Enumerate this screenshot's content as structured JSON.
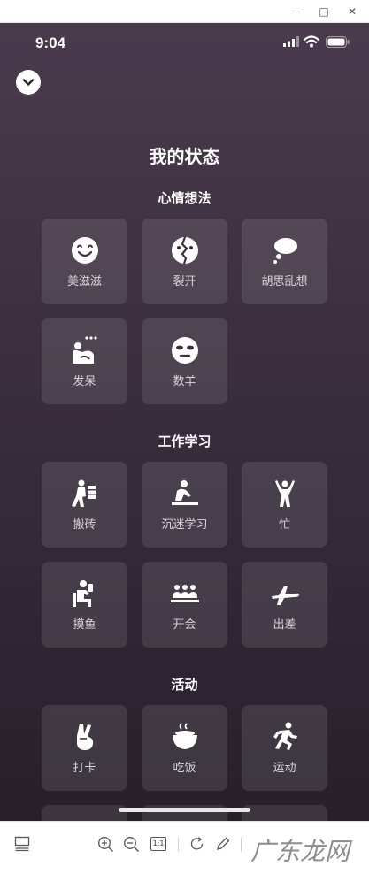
{
  "window": {
    "minimize_glyph": "—",
    "maximize_glyph": "□",
    "close_glyph": "✕"
  },
  "status": {
    "time": "9:04"
  },
  "page": {
    "title": "我的状态"
  },
  "sections": [
    {
      "title": "心情想法",
      "items": [
        {
          "label": "美滋滋",
          "icon": "smiling-face-icon"
        },
        {
          "label": "裂开",
          "icon": "cracked-face-icon"
        },
        {
          "label": "胡思乱想",
          "icon": "thought-cloud-icon"
        },
        {
          "label": "发呆",
          "icon": "zoning-out-icon"
        },
        {
          "label": "数羊",
          "icon": "face-mask-icon"
        }
      ]
    },
    {
      "title": "工作学习",
      "items": [
        {
          "label": "搬砖",
          "icon": "carrying-bricks-icon"
        },
        {
          "label": "沉迷学习",
          "icon": "studying-person-icon"
        },
        {
          "label": "忙",
          "icon": "busy-person-icon"
        },
        {
          "label": "摸鱼",
          "icon": "slacking-person-icon"
        },
        {
          "label": "开会",
          "icon": "meeting-icon"
        },
        {
          "label": "出差",
          "icon": "airplane-icon"
        }
      ]
    },
    {
      "title": "活动",
      "items": [
        {
          "label": "打卡",
          "icon": "peace-hand-icon"
        },
        {
          "label": "吃饭",
          "icon": "rice-bowl-icon"
        },
        {
          "label": "运动",
          "icon": "running-icon"
        }
      ]
    }
  ],
  "toolbar": {
    "zoom_label": "1:1",
    "watermark": "广东龙网"
  },
  "colors": {
    "background_top": "#4a3a4d",
    "background_bottom": "#272029",
    "card": "rgba(255,255,255,0.10)",
    "text": "#ffffff"
  }
}
